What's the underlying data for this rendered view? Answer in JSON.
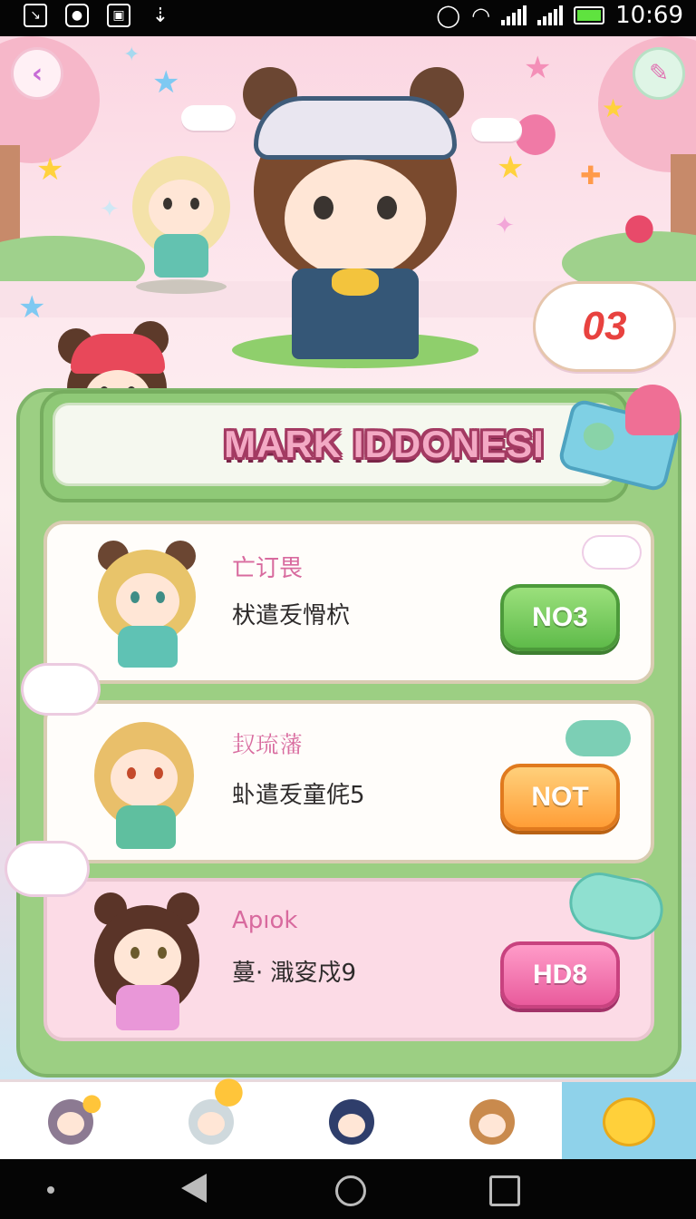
{
  "status_bar": {
    "time": "10:69"
  },
  "header": {
    "back_icon": "chevron-left-icon",
    "top_right_icon": "magic-wand-icon",
    "level_badge": "03"
  },
  "panel": {
    "title": "MARK IDDONESI",
    "items": [
      {
        "name": "亡订畏",
        "desc": "枤遣叐愲柼",
        "button": "NO3",
        "button_color": "#5fbb4a"
      },
      {
        "name": "𡊋琉藩",
        "desc": "虲遣叐童侂5",
        "button": "NOT",
        "button_color": "#ff9e37"
      },
      {
        "name": "Apıok",
        "desc": "蔓· 濈叜戍9",
        "button": "HD8",
        "button_color": "#e95b9c"
      }
    ]
  },
  "tabbar": {
    "tabs": [
      "tab-character-1",
      "tab-character-2",
      "tab-character-3",
      "tab-character-4",
      "tab-mascot"
    ],
    "active_index": 4
  },
  "colors": {
    "panel_green": "#9ccf83",
    "title_pink": "#f3a9c4",
    "active_tab": "#8fd2ea"
  }
}
